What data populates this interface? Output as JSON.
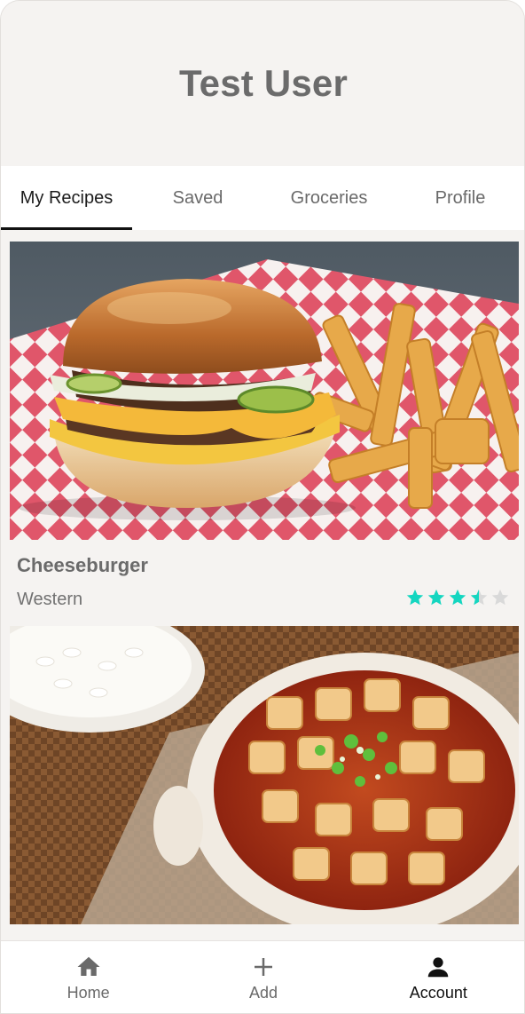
{
  "header": {
    "title": "Test User"
  },
  "tabs": [
    {
      "label": "My Recipes",
      "active": true
    },
    {
      "label": "Saved",
      "active": false
    },
    {
      "label": "Groceries",
      "active": false
    },
    {
      "label": "Profile",
      "active": false
    }
  ],
  "recipes": [
    {
      "title": "Cheeseburger",
      "cuisine": "Western",
      "rating": 3.5,
      "rating_max": 5,
      "image": "cheeseburger-with-fries-photo"
    },
    {
      "title": "",
      "cuisine": "",
      "image": "mapo-tofu-with-rice-photo"
    }
  ],
  "bottom_nav": [
    {
      "label": "Home",
      "icon": "home-icon",
      "active": false
    },
    {
      "label": "Add",
      "icon": "plus-icon",
      "active": false
    },
    {
      "label": "Account",
      "icon": "person-icon",
      "active": true
    }
  ],
  "colors": {
    "star_filled": "#14d6c0",
    "star_empty": "#d9d9d9",
    "background": "#f5f3f1",
    "title_gray": "#6b6b6b"
  }
}
